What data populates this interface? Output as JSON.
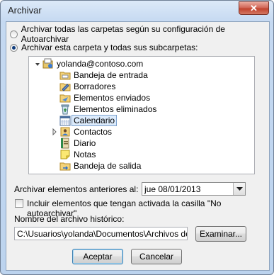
{
  "window": {
    "title": "Archivar",
    "close_label": "✕"
  },
  "options": {
    "archive_all_label": "Archivar todas las carpetas según su configuración de Autoarchivar",
    "archive_this_label": "Archivar esta carpeta y todas sus subcarpetas:",
    "selected": "archive_this"
  },
  "tree": {
    "root": "yolanda@contoso.com",
    "items": [
      {
        "label": "Bandeja de entrada",
        "icon": "inbox-icon"
      },
      {
        "label": "Borradores",
        "icon": "drafts-icon"
      },
      {
        "label": "Elementos enviados",
        "icon": "sent-items-icon"
      },
      {
        "label": "Elementos eliminados",
        "icon": "deleted-items-icon"
      },
      {
        "label": "Calendario",
        "icon": "calendar-icon",
        "selected": true
      },
      {
        "label": "Contactos",
        "icon": "contacts-icon",
        "expandable": true
      },
      {
        "label": "Diario",
        "icon": "journal-icon"
      },
      {
        "label": "Notas",
        "icon": "notes-icon"
      },
      {
        "label": "Bandeja de salida",
        "icon": "outbox-icon"
      }
    ]
  },
  "older_than": {
    "label": "Archivar elementos anteriores al:",
    "value": "jue 08/01/2013"
  },
  "no_autoarchive": {
    "label": "Incluir elementos que tengan activada la casilla \"No autoarchivar\"",
    "checked": false
  },
  "archive_file": {
    "label": "Nombre del archivo histórico:",
    "value": "C:\\Usuarios\\yolanda\\Documentos\\Archivos de",
    "browse_label": "Examinar..."
  },
  "buttons": {
    "ok_label": "Aceptar",
    "cancel_label": "Cancelar"
  },
  "colors": {
    "title_bar": "#c5d9f1",
    "close_button": "#c1432e",
    "selection": "#dcebfc",
    "dialog_bg": "#f0f0f0"
  }
}
